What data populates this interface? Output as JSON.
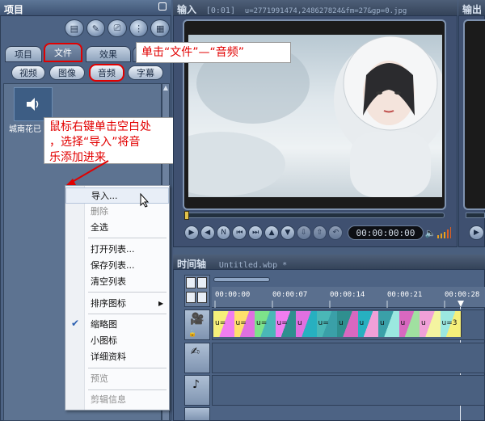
{
  "left": {
    "title": "项目",
    "tabs": [
      "项目",
      "文件",
      "效果"
    ],
    "subtabs": [
      "视频",
      "图像",
      "音频",
      "字幕"
    ],
    "file_label": "城南花已"
  },
  "input": {
    "title": "输入",
    "time": "[0:01]",
    "filename": "u=2771991474,248627824&fm=27&gp=0.jpg",
    "timecode": "00:00:00:00"
  },
  "output": {
    "title": "输出"
  },
  "callouts": {
    "c1": "单击“文件”—“音频”",
    "c2_lines": [
      "鼠标右键单击空白处",
      "，选择“导入”将音",
      "乐添加进来"
    ]
  },
  "context_menu": {
    "items": [
      {
        "label": "导入...",
        "enabled": true
      },
      {
        "label": "删除",
        "enabled": false
      },
      {
        "label": "全选",
        "enabled": true
      },
      {
        "label": "打开列表...",
        "enabled": true
      },
      {
        "label": "保存列表...",
        "enabled": true
      },
      {
        "label": "清空列表",
        "enabled": true
      },
      {
        "label": "排序图标",
        "enabled": true,
        "submenu": true
      },
      {
        "label": "缩略图",
        "enabled": true,
        "checked": true
      },
      {
        "label": "小图标",
        "enabled": true
      },
      {
        "label": "详细资料",
        "enabled": true
      },
      {
        "label": "预览",
        "enabled": false
      },
      {
        "label": "剪辑信息",
        "enabled": false
      }
    ]
  },
  "timeline": {
    "title": "时间轴",
    "filename": "Untitled.wbp *",
    "ruler": [
      "00:00:00",
      "00:00:07",
      "00:00:14",
      "00:00:21",
      "00:00:28"
    ],
    "clip_labels": [
      "u=",
      "u=",
      "u=",
      "u=",
      "u",
      "u=",
      "u",
      "u",
      "u",
      "u",
      "u",
      "u=3"
    ]
  },
  "colors": {
    "accent_red": "#e10000",
    "clips": [
      "#f5f07a",
      "#ffe06b",
      "#7de38a",
      "#f07df0",
      "#e070e0",
      "#4ab7b7",
      "#2f8f8f",
      "#27b0c0",
      "#3aa0a8",
      "#d868c0",
      "#f0a0d8",
      "#9be8e0",
      "#a0e0a0",
      "#f4f4a0"
    ]
  },
  "icons": {
    "transport": [
      "play-icon",
      "prev-icon",
      "next-icon",
      "start-icon",
      "end-icon",
      "up-icon",
      "down-icon",
      "mark-in-icon",
      "mark-out-icon",
      "undo-icon"
    ]
  }
}
